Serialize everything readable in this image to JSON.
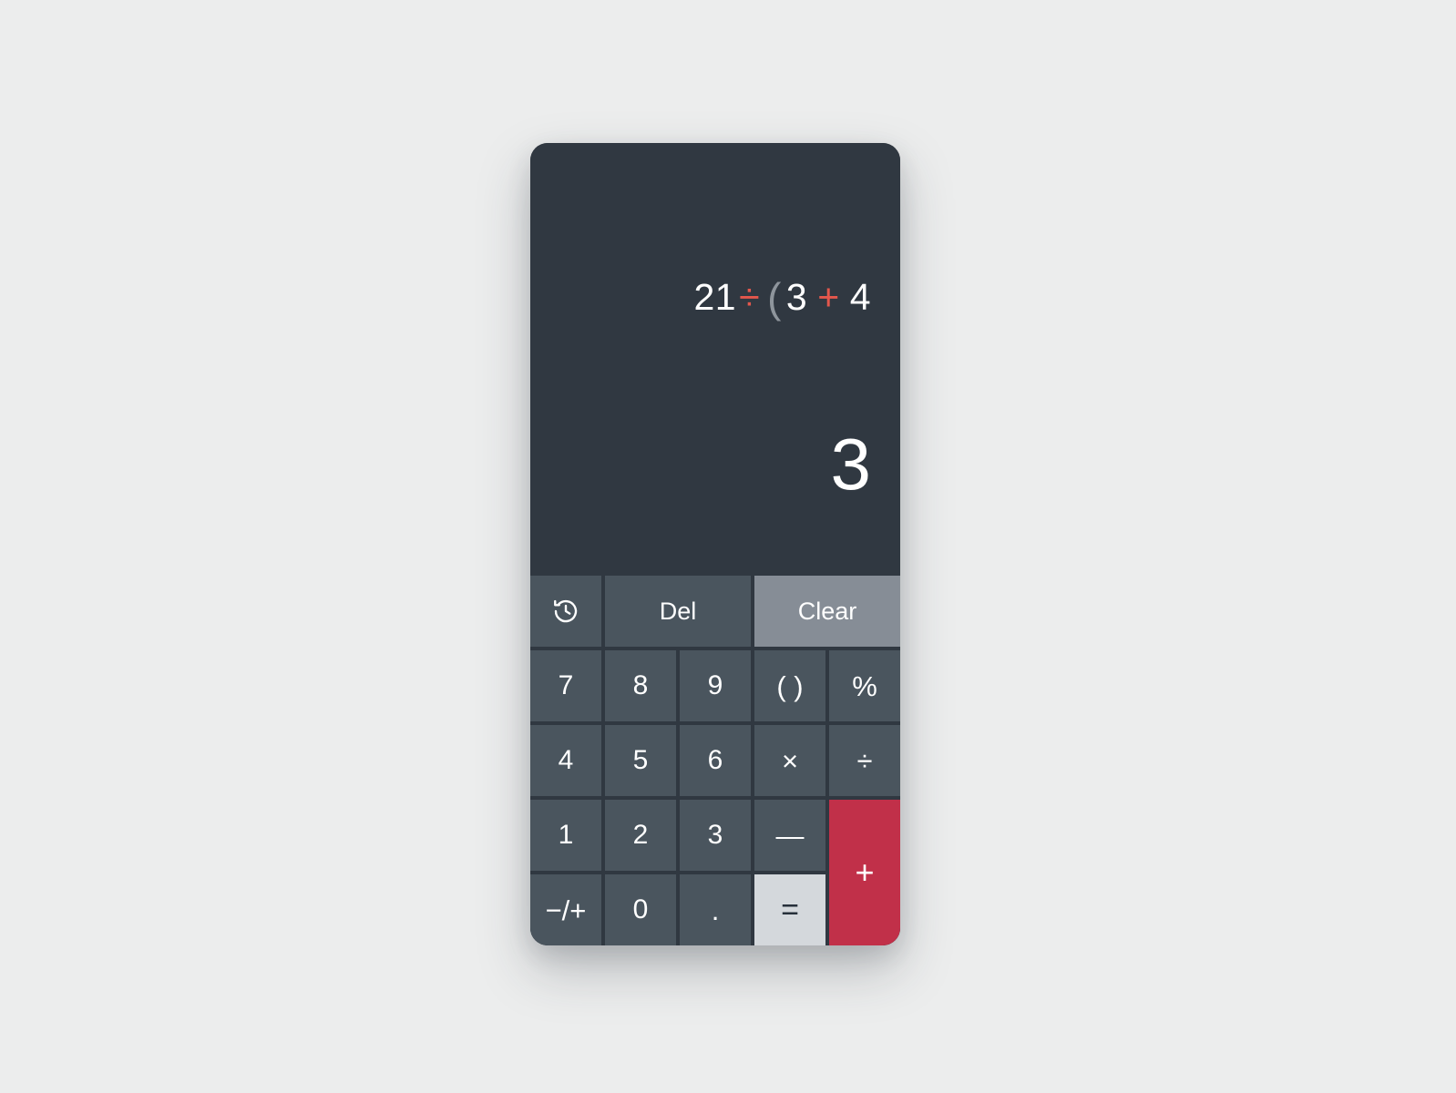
{
  "app": {
    "name": "calculator",
    "background_color": "#eceded",
    "card_color": "#303841"
  },
  "display": {
    "expression_text": "21 ÷ ( 3 + 4",
    "expression_tokens": [
      {
        "text": "21",
        "kind": "number"
      },
      {
        "text": "÷",
        "kind": "operator"
      },
      {
        "text": "(",
        "kind": "paren"
      },
      {
        "text": "3",
        "kind": "number"
      },
      {
        "text": "+",
        "kind": "operator"
      },
      {
        "text": "4",
        "kind": "number"
      }
    ],
    "result": "3",
    "colors": {
      "number": "#ffffff",
      "operator": "#e4574c",
      "paren": "#8e959c",
      "result": "#ffffff"
    }
  },
  "keypad": {
    "colors": {
      "key": "#4a555e",
      "clear": "#868d96",
      "equals": "#d4d8dc",
      "plus": "#c13049"
    },
    "function_row": [
      {
        "id": "history",
        "label": "",
        "icon": "history-icon"
      },
      {
        "id": "delete",
        "label": "Del",
        "icon": ""
      },
      {
        "id": "clear",
        "label": "Clear",
        "icon": ""
      }
    ],
    "keys": [
      {
        "id": "seven",
        "label": "7"
      },
      {
        "id": "eight",
        "label": "8"
      },
      {
        "id": "nine",
        "label": "9"
      },
      {
        "id": "parens",
        "label": "( )"
      },
      {
        "id": "percent",
        "label": "%"
      },
      {
        "id": "four",
        "label": "4"
      },
      {
        "id": "five",
        "label": "5"
      },
      {
        "id": "six",
        "label": "6"
      },
      {
        "id": "multiply",
        "label": "×"
      },
      {
        "id": "divide",
        "label": "÷"
      },
      {
        "id": "one",
        "label": "1"
      },
      {
        "id": "two",
        "label": "2"
      },
      {
        "id": "three",
        "label": "3"
      },
      {
        "id": "minus",
        "label": "—"
      },
      {
        "id": "plus",
        "label": "+"
      },
      {
        "id": "sign",
        "label": "−/+"
      },
      {
        "id": "zero",
        "label": "0"
      },
      {
        "id": "decimal",
        "label": "."
      },
      {
        "id": "equals",
        "label": "="
      }
    ]
  }
}
